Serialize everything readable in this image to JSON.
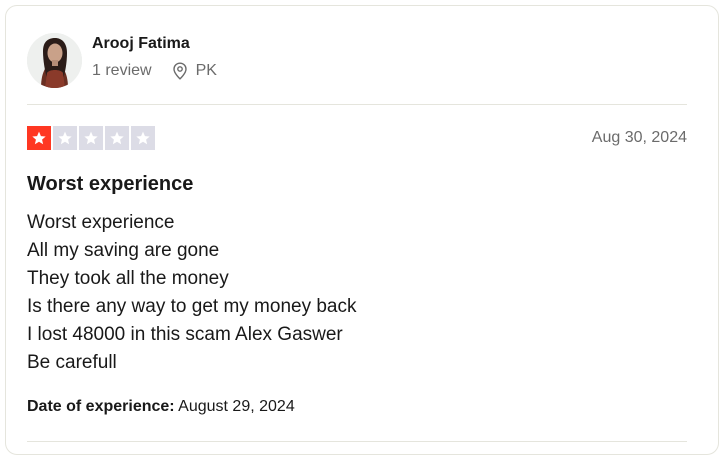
{
  "review": {
    "consumer": {
      "name": "Arooj Fatima",
      "review_count": "1 review",
      "country": "PK"
    },
    "rating": 1,
    "rating_max": 5,
    "star_color_filled": "#ff3722",
    "star_color_empty": "#dcdce6",
    "date": "Aug 30, 2024",
    "title": "Worst experience",
    "body_lines": [
      "Worst experience",
      "All my saving are gone",
      "They took all the money",
      "Is there any way to get my money back",
      "I lost 48000 in this scam Alex Gaswer",
      "Be carefull"
    ],
    "experience_label": "Date of experience:",
    "experience_date": "August 29, 2024"
  }
}
